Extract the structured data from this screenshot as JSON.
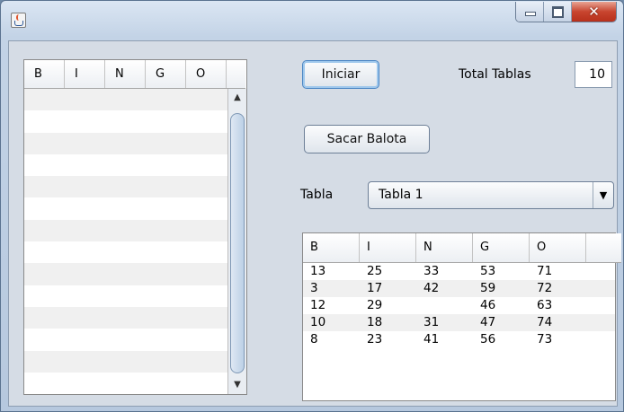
{
  "window": {
    "title": ""
  },
  "bingo_board": {
    "headers": [
      "B",
      "I",
      "N",
      "G",
      "O",
      ""
    ],
    "row_count": 14
  },
  "controls": {
    "start_button": "Iniciar",
    "draw_button": "Sacar Balota",
    "total_tables_label": "Total Tablas",
    "total_tables_value": "10",
    "table_label": "Tabla",
    "table_select_value": "Tabla 1"
  },
  "table": {
    "headers": [
      "B",
      "I",
      "N",
      "G",
      "O"
    ],
    "rows": [
      [
        "13",
        "25",
        "33",
        "53",
        "71"
      ],
      [
        "3",
        "17",
        "42",
        "59",
        "72"
      ],
      [
        "12",
        "29",
        "",
        "46",
        "63"
      ],
      [
        "10",
        "18",
        "31",
        "47",
        "74"
      ],
      [
        "8",
        "23",
        "41",
        "56",
        "73"
      ]
    ]
  }
}
